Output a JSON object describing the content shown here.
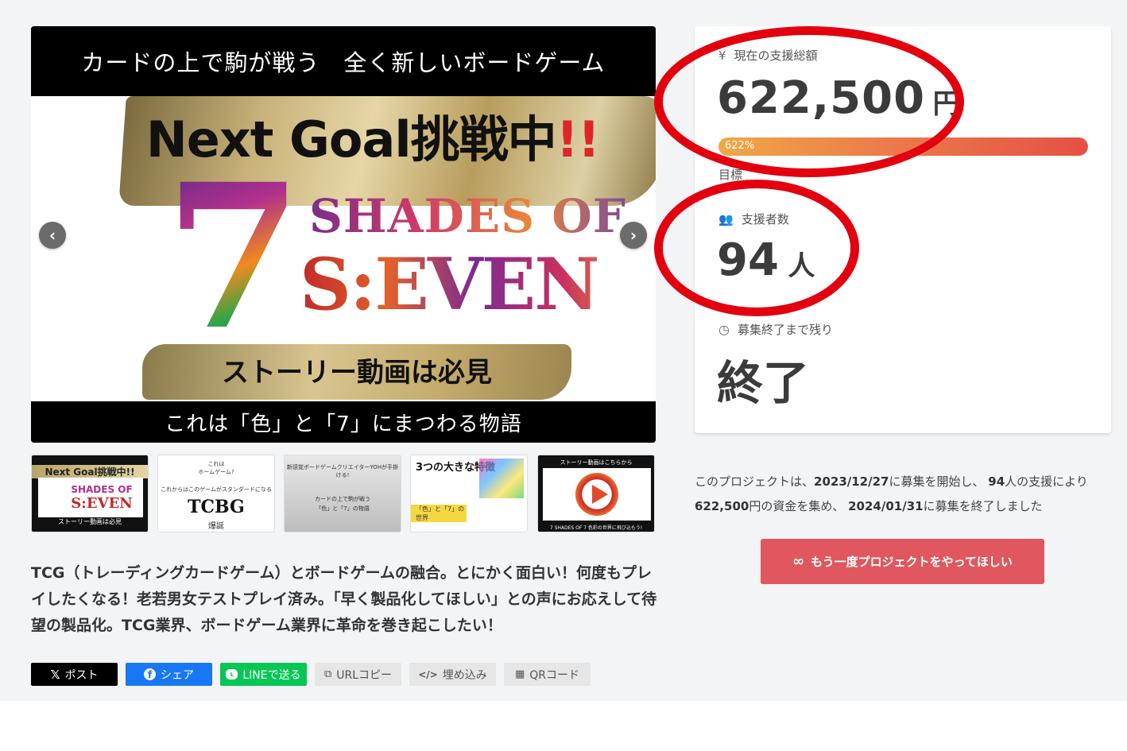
{
  "main_visual": {
    "top_text": "カードの上で駒が戦う　全く新しいボードゲーム",
    "next_goal": "Next Goal挑戦中",
    "next_goal_excl": "!!",
    "seven_numeral": "7",
    "shades_of": "SHADES OF",
    "seven_word": "S:EVEN",
    "story_text": "ストーリー動画は必見",
    "bottom_text": "これは「色」と「7」にまつわる物語",
    "prev_arrow": "‹",
    "next_arrow": "›"
  },
  "thumbnails": [
    {
      "line1": "Next Goal挑戦中!!",
      "line2": "SHADES OF",
      "line3": "S:EVEN",
      "line4": "ストーリー動画は必見"
    },
    {
      "line1": "これは",
      "line2": "ホームゲーム?",
      "line3": "これからはこのゲームがスタンダードになる",
      "line4": "TCBG",
      "line5": "爆誕"
    },
    {
      "line1": "新感覚ボードゲームクリエイターYOHが手掛ける!",
      "line2": "カードの上で駒が戦う",
      "line3": "「色」と「7」の物語"
    },
    {
      "line1": "3つの大きな特徴",
      "line2": "「色」と「7」の世界"
    },
    {
      "line1": "ストーリー動画はこちらから",
      "line2": "7 SHADES OF 7 色彩の世界に飛び込もう!"
    }
  ],
  "description": "TCG（トレーディングカードゲーム）とボードゲームの融合。とにかく面白い！何度もプレイしたくなる！老若男女テストプレイ済み。「早く製品化してほしい」との声にお応えして待望の製品化。TCG業界、ボードゲーム業界に革命を巻き起こしたい！",
  "share": {
    "post": "ポスト",
    "share": "シェア",
    "line": "LINEで送る",
    "url_copy": "URLコピー",
    "embed": "埋め込み",
    "qr": "QRコード"
  },
  "stats": {
    "total_label": "現在の支援総額",
    "total_amount": "622,500",
    "total_unit": "円",
    "progress_pct": 100,
    "progress_text": "622%",
    "goal_label_partial": "目標",
    "supporters_label": "支援者数",
    "supporters_count": "94",
    "supporters_unit": "人",
    "remaining_label": "募集終了まで残り",
    "remaining_value": "終了"
  },
  "summary": {
    "part1": "このプロジェクトは、",
    "start_date": "2023/12/27",
    "part2": "に募集を開始し、",
    "supporters": "94",
    "part3": "人の支援により",
    "amount": "622,500",
    "part4": "円の資金を集め、",
    "end_date": "2024/01/31",
    "part5": "に募集を終了しました"
  },
  "cta": {
    "icon": "∞",
    "label": "もう一度プロジェクトをやってほしい"
  },
  "colors": {
    "cta": "#e0575f",
    "annotation_red": "#e2000f",
    "progress_start": "#f0a846",
    "progress_end": "#e55045",
    "line_green": "#06c755",
    "facebook_blue": "#1877f2"
  }
}
